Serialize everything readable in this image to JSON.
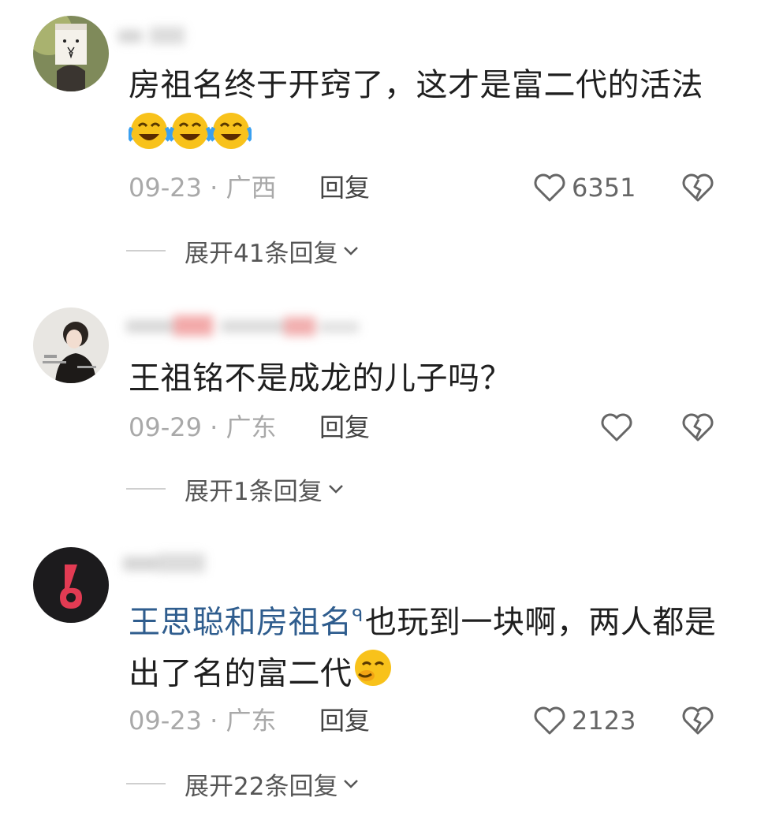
{
  "comments": [
    {
      "text": "房祖名终于开窍了，这才是富二代的活法",
      "date": "09-23",
      "separator": "·",
      "location": "广西",
      "reply_label": "回复",
      "likes": "6351",
      "expand_label": "展开41条回复"
    },
    {
      "text": "王祖铭不是成龙的儿子吗？",
      "date": "09-29",
      "separator": "·",
      "location": "广东",
      "reply_label": "回复",
      "likes": "",
      "expand_label": "展开1条回复"
    },
    {
      "mention": "王思聪和房祖名",
      "mention_icon": "ᑫ",
      "text": "也玩到一块啊，两人都是出了名的富二代",
      "date": "09-23",
      "separator": "·",
      "location": "广东",
      "reply_label": "回复",
      "likes": "2123",
      "expand_label": "展开22条回复"
    }
  ],
  "icons": {
    "like": "heart-outline-icon",
    "dislike": "broken-heart-icon",
    "expand": "chevron-down-icon",
    "emoji_1": "laugh-cry-emoji",
    "emoji_2": "smirk-emoji"
  },
  "colors": {
    "text": "#1f1f1f",
    "meta": "#a9a9a9",
    "mention": "#2f5d8e",
    "emoji_yellow": "#f8c21b"
  }
}
